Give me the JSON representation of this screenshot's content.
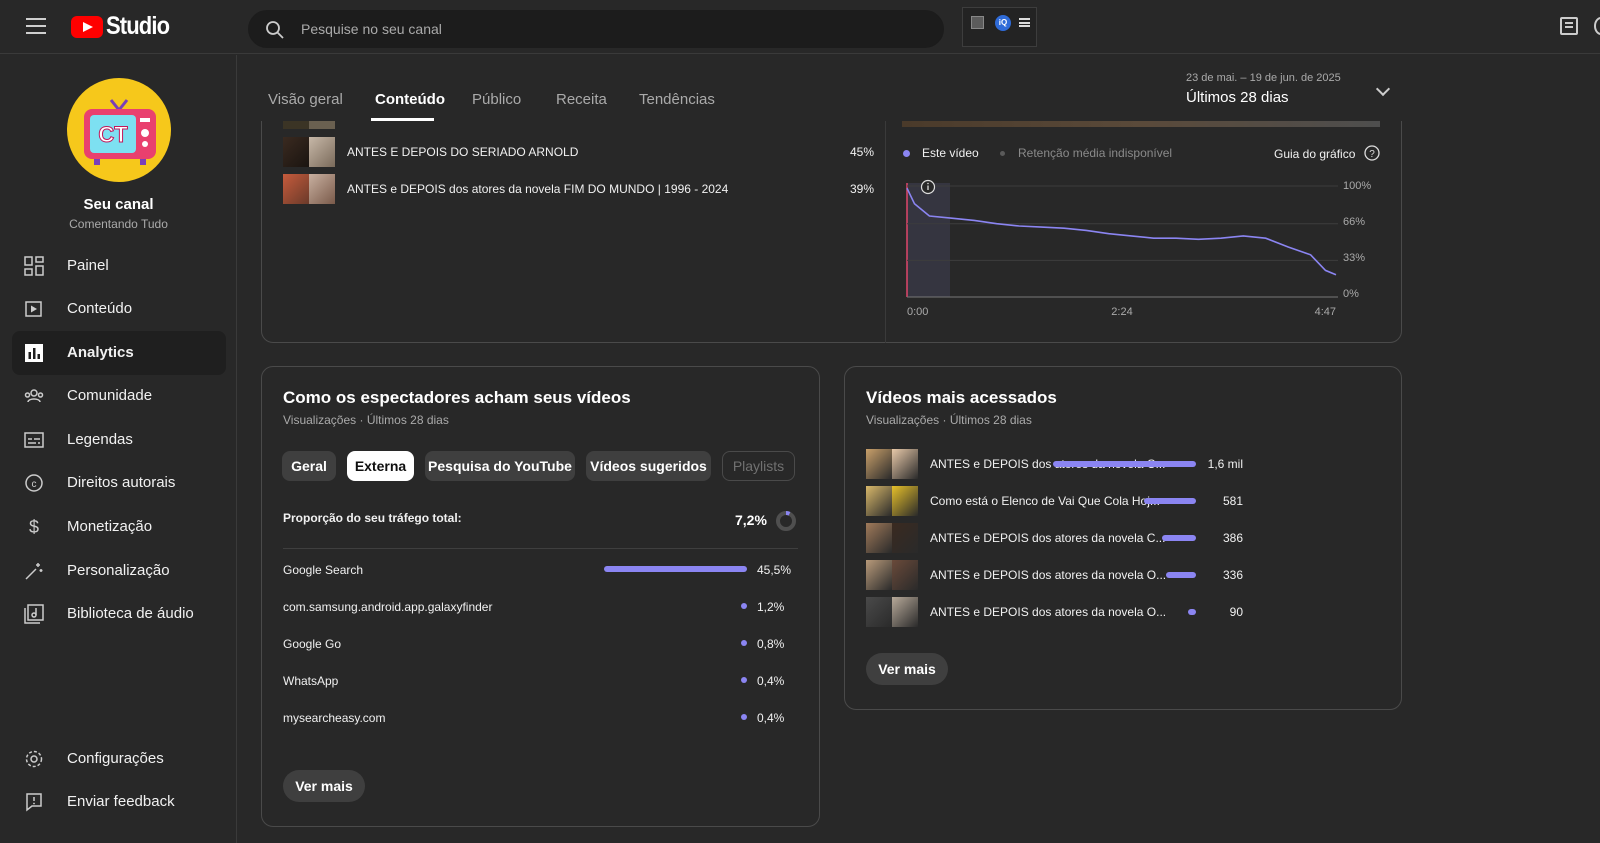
{
  "app": {
    "logo_text": "Studio"
  },
  "search": {
    "placeholder": "Pesquise no seu canal"
  },
  "channel": {
    "name": "Seu canal",
    "subtitle": "Comentando Tudo",
    "avatar_text": "CT"
  },
  "sidebar": {
    "items": [
      {
        "label": "Painel",
        "icon": "dashboard-icon"
      },
      {
        "label": "Conteúdo",
        "icon": "content-icon"
      },
      {
        "label": "Analytics",
        "icon": "analytics-icon"
      },
      {
        "label": "Comunidade",
        "icon": "community-icon"
      },
      {
        "label": "Legendas",
        "icon": "subtitles-icon"
      },
      {
        "label": "Direitos autorais",
        "icon": "copyright-icon"
      },
      {
        "label": "Monetização",
        "icon": "dollar-icon"
      },
      {
        "label": "Personalização",
        "icon": "magic-wand-icon"
      },
      {
        "label": "Biblioteca de áudio",
        "icon": "audio-library-icon"
      }
    ],
    "bottom": [
      {
        "label": "Configurações",
        "icon": "gear-icon"
      },
      {
        "label": "Enviar feedback",
        "icon": "feedback-icon"
      }
    ]
  },
  "tabs": [
    "Visão geral",
    "Conteúdo",
    "Público",
    "Receita",
    "Tendências"
  ],
  "active_tab": "Conteúdo",
  "date": {
    "range": "23 de mai. – 19 de jun. de 2025",
    "label": "Últimos 28 dias"
  },
  "retention_list": [
    {
      "title": "ANTES E DEPOIS DO SERIADO ARNOLD",
      "pct": "45%"
    },
    {
      "title": "ANTES e DEPOIS dos atores da novela FIM DO MUNDO | 1996 - 2024",
      "pct": "39%"
    }
  ],
  "retention_chart": {
    "legend_this": "Este vídeo",
    "legend_avg": "Retenção média indisponível",
    "guide": "Guia do gráfico",
    "y_ticks": [
      "100%",
      "66%",
      "33%",
      "0%"
    ],
    "x_ticks": [
      "0:00",
      "2:24",
      "4:47"
    ]
  },
  "chart_data": {
    "type": "line",
    "x": [
      "0:00",
      "0:05",
      "0:15",
      "0:30",
      "0:45",
      "1:00",
      "1:15",
      "1:30",
      "1:45",
      "2:00",
      "2:15",
      "2:30",
      "2:45",
      "3:00",
      "3:15",
      "3:30",
      "3:45",
      "4:00",
      "4:15",
      "4:30",
      "4:40",
      "4:47"
    ],
    "series": [
      {
        "name": "Este vídeo",
        "values": [
          98,
          84,
          73,
          71,
          69,
          66,
          64,
          63,
          62,
          60,
          57,
          55,
          53,
          53,
          52,
          53,
          55,
          53,
          45,
          38,
          24,
          20
        ]
      }
    ],
    "ylim": [
      0,
      100
    ],
    "y_ticks": [
      "100%",
      "66%",
      "33%",
      "0%"
    ],
    "x_ticks": [
      "0:00",
      "2:24",
      "4:47"
    ]
  },
  "discovery": {
    "title": "Como os espectadores acham seus vídeos",
    "subtitle": "Visualizações · Últimos 28 dias",
    "chips": [
      "Geral",
      "Externa",
      "Pesquisa do YouTube",
      "Vídeos sugeridos",
      "Playlists"
    ],
    "selected_chip": "Externa",
    "share_label": "Proporção do seu tráfego total:",
    "share_value": "7,2%",
    "share_fraction": 0.072,
    "sources": [
      {
        "name": "Google Search",
        "value": "45,5%",
        "pct": 45.5
      },
      {
        "name": "com.samsung.android.app.galaxyfinder",
        "value": "1,2%",
        "pct": 1.2
      },
      {
        "name": "Google Go",
        "value": "0,8%",
        "pct": 0.8
      },
      {
        "name": "WhatsApp",
        "value": "0,4%",
        "pct": 0.4
      },
      {
        "name": "mysearcheasy.com",
        "value": "0,4%",
        "pct": 0.4
      }
    ],
    "more": "Ver mais"
  },
  "top_videos": {
    "title": "Vídeos mais acessados",
    "subtitle": "Visualizações · Últimos 28 dias",
    "items": [
      {
        "title": "ANTES e DEPOIS dos atores da novela C...",
        "value": "1,6 mil",
        "views": 1600
      },
      {
        "title": "Como está o Elenco de Vai Que Cola Hoj...",
        "value": "581",
        "views": 581
      },
      {
        "title": "ANTES e DEPOIS dos atores da novela C...",
        "value": "386",
        "views": 386
      },
      {
        "title": "ANTES e DEPOIS dos atores da novela O...",
        "value": "336",
        "views": 336
      },
      {
        "title": "ANTES e DEPOIS dos atores da novela O...",
        "value": "90",
        "views": 90
      }
    ],
    "more": "Ver mais"
  },
  "colors": {
    "accent": "#8b85f2",
    "brand": "#ff0000",
    "avatar": "#f6c81b"
  }
}
